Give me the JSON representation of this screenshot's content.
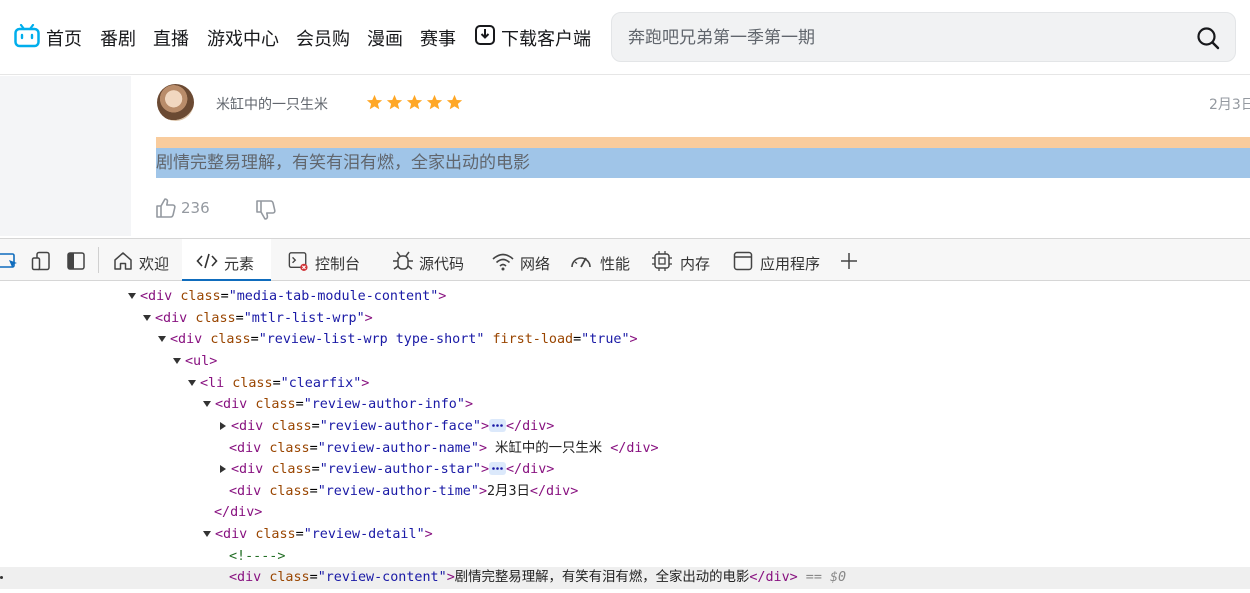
{
  "nav": {
    "items": [
      "首页",
      "番剧",
      "直播",
      "游戏中心",
      "会员购",
      "漫画",
      "赛事"
    ],
    "download_label": "下载客户端",
    "search_placeholder": "奔跑吧兄弟第一季第一期"
  },
  "review": {
    "author_name": "米缸中的一只生米",
    "rating": 5,
    "rating_max": 5,
    "time": "2月3日",
    "content": "剧情完整易理解，有笑有泪有燃，全家出动的电影",
    "like_count": "236"
  },
  "devtools": {
    "tabs": [
      {
        "label": "欢迎",
        "icon": "home-icon"
      },
      {
        "label": "元素",
        "icon": "code-icon",
        "active": true
      },
      {
        "label": "控制台",
        "icon": "console-icon"
      },
      {
        "label": "源代码",
        "icon": "bug-icon"
      },
      {
        "label": "网络",
        "icon": "wifi-icon"
      },
      {
        "label": "性能",
        "icon": "gauge-icon"
      },
      {
        "label": "内存",
        "icon": "chip-icon"
      },
      {
        "label": "应用程序",
        "icon": "app-window-icon"
      }
    ],
    "dom_lines": [
      {
        "open": "<div",
        "attrs": [
          [
            "class",
            "media-tab-module-content"
          ]
        ],
        "close": ">"
      },
      {
        "open": "<div",
        "attrs": [
          [
            "class",
            "mtlr-list-wrp"
          ]
        ],
        "close": ">"
      },
      {
        "open": "<div",
        "attrs": [
          [
            "class",
            "review-list-wrp type-short"
          ],
          [
            "first-load",
            "true"
          ]
        ],
        "close": ">"
      },
      {
        "open": "<ul",
        "attrs": [],
        "close": ">"
      },
      {
        "open": "<li",
        "attrs": [
          [
            "class",
            "clearfix"
          ]
        ],
        "close": ">"
      },
      {
        "open": "<div",
        "attrs": [
          [
            "class",
            "review-author-info"
          ]
        ],
        "close": ">"
      },
      {
        "open": "<div",
        "attrs": [
          [
            "class",
            "review-author-face"
          ]
        ],
        "close": ">",
        "end": "</div>"
      },
      {
        "open": "<div",
        "attrs": [
          [
            "class",
            "review-author-name"
          ]
        ],
        "close": ">",
        "text": " 米缸中的一只生米 ",
        "end": "</div>"
      },
      {
        "open": "<div",
        "attrs": [
          [
            "class",
            "review-author-star"
          ]
        ],
        "close": ">",
        "end": "</div>"
      },
      {
        "open": "<div",
        "attrs": [
          [
            "class",
            "review-author-time"
          ]
        ],
        "close": ">",
        "text": "2月3日",
        "end": "</div>"
      },
      {
        "end": "</div>"
      },
      {
        "open": "<div",
        "attrs": [
          [
            "class",
            "review-detail"
          ]
        ],
        "close": ">"
      },
      {
        "comment": "<!---->"
      },
      {
        "open": "<div",
        "attrs": [
          [
            "class",
            "review-content"
          ]
        ],
        "close": ">",
        "text": "剧情完整易理解，有笑有泪有燃，全家出动的电影",
        "end": "</div>",
        "suffix": " == $0"
      }
    ]
  },
  "colors": {
    "accent_blue": "#00aeec",
    "star": "#ffa726",
    "tag": "#881280",
    "attr_name": "#994500",
    "attr_value": "#1a1aa6",
    "highlight_margin": "#f9cc9d",
    "highlight_content": "#a0c5e8"
  }
}
